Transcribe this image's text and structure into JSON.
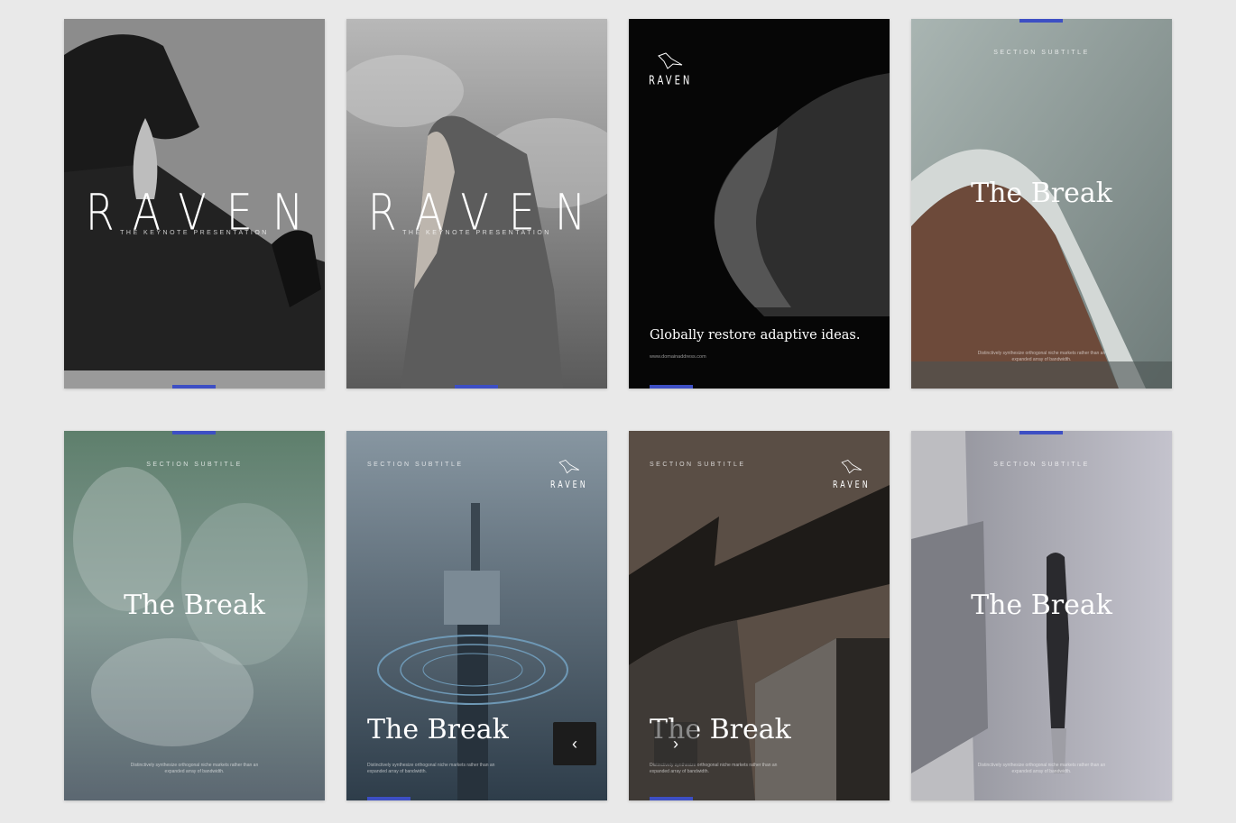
{
  "cards": [
    {
      "title": "RAVEN",
      "subtitle": "THE KEYNOTE PRESENTATION"
    },
    {
      "title": "RAVEN",
      "subtitle": "THE KEYNOTE PRESENTATION"
    },
    {
      "logo": "RAVEN",
      "tagline": "Globally restore adaptive ideas.",
      "url": "www.domainaddress.com"
    },
    {
      "section": "SECTION SUBTITLE",
      "title": "The Break",
      "body": "Distinctively synthesize orthogonal niche markets rather than an expanded array of bandwidth."
    },
    {
      "section": "SECTION SUBTITLE",
      "title": "The Break",
      "body": "Distinctively synthesize orthogonal niche markets rather than an expanded array of bandwidth."
    },
    {
      "section": "SECTION SUBTITLE",
      "logo": "RAVEN",
      "title": "The Break",
      "body": "Distinctively synthesize orthogonal niche markets rather than an expanded array of bandwidth."
    },
    {
      "section": "SECTION SUBTITLE",
      "logo": "RAVEN",
      "title": "The Break",
      "body": "Distinctively synthesize orthogonal niche markets rather than an expanded array of bandwidth."
    },
    {
      "section": "SECTION SUBTITLE",
      "title": "The Break",
      "body": "Distinctively synthesize orthogonal niche markets rather than an expanded array of bandwidth."
    }
  ],
  "nav": {
    "prev_icon": "chevron-left-icon",
    "next_icon": "chevron-right-icon",
    "prev_glyph": "‹",
    "next_glyph": "›"
  },
  "colors": {
    "accent": "#3d4fc4",
    "background": "#e9e9e9"
  }
}
